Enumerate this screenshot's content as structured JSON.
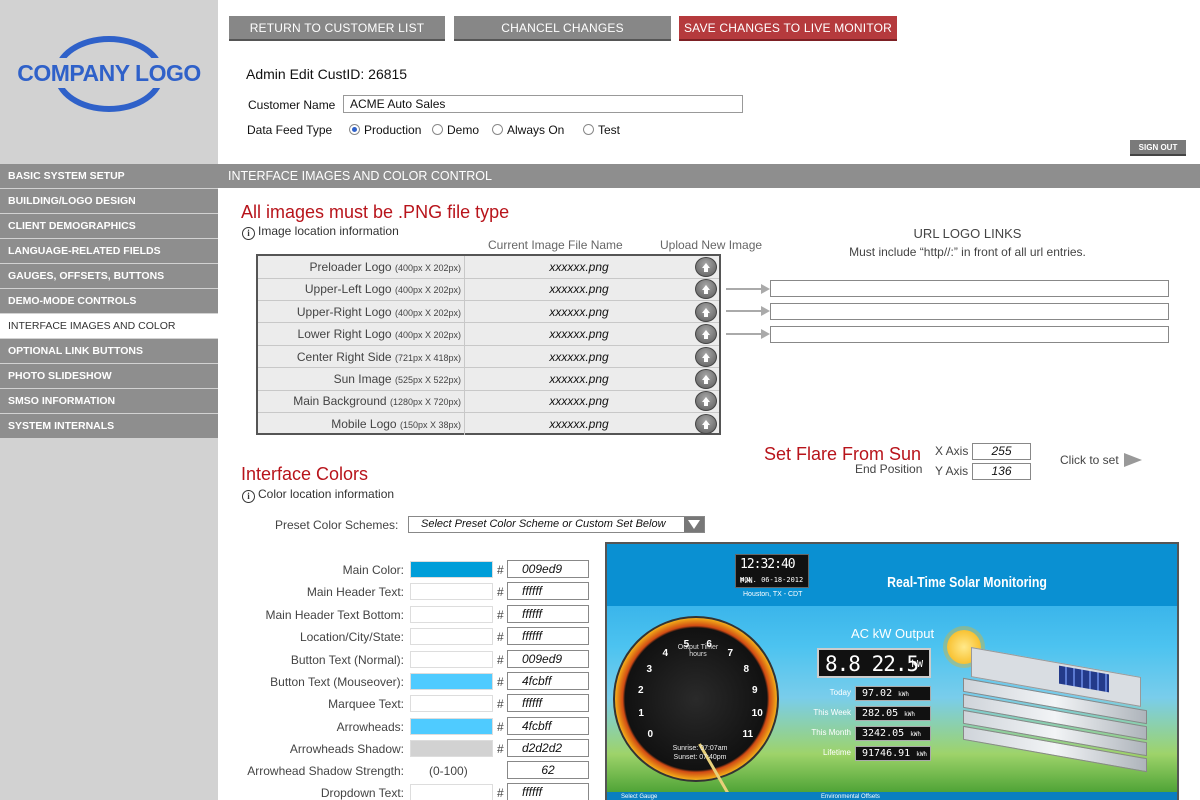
{
  "colors": {
    "brand_blue": "#2f61c9",
    "sidebar_gray": "#8e8e8e",
    "accent_red": "#b53a3d",
    "title_red": "#b8141b"
  },
  "logo": {
    "text": "COMPANY LOGO"
  },
  "top_buttons": {
    "return_label": "RETURN TO CUSTOMER LIST",
    "cancel_label": "CHANCEL CHANGES",
    "save_label": "SAVE CHANGES TO LIVE MONITOR"
  },
  "admin": {
    "title": "Admin Edit CustID: 26815"
  },
  "customer": {
    "name_label": "Customer Name",
    "name_value": "ACME Auto Sales"
  },
  "feed": {
    "label": "Data Feed Type",
    "options": [
      "Production",
      "Demo",
      "Always On",
      "Test"
    ],
    "selected": "Production"
  },
  "signout_label": "SIGN OUT",
  "nav": {
    "items": [
      "BASIC SYSTEM SETUP",
      "BUILDING/LOGO DESIGN",
      "CLIENT DEMOGRAPHICS",
      "LANGUAGE-RELATED FIELDS",
      "GAUGES, OFFSETS, BUTTONS",
      "DEMO-MODE CONTROLS",
      "INTERFACE IMAGES AND COLOR",
      "OPTIONAL LINK BUTTONS",
      "PHOTO SLIDESHOW",
      "SMSO INFORMATION",
      "SYSTEM INTERNALS"
    ],
    "active_index": 6
  },
  "section_title": "INTERFACE IMAGES AND COLOR CONTROL",
  "images": {
    "title": "All images must be .PNG file type",
    "info": "Image location information",
    "col_current": "Current Image File Name",
    "col_upload": "Upload New Image",
    "rows": [
      {
        "name": "Preloader Logo",
        "size": "(400px X 202px)",
        "file": "xxxxxx.png"
      },
      {
        "name": "Upper-Left Logo",
        "size": "(400px X 202px)",
        "file": "xxxxxx.png"
      },
      {
        "name": "Upper-Right Logo",
        "size": "(400px X 202px)",
        "file": "xxxxxx.png"
      },
      {
        "name": "Lower Right Logo",
        "size": "(400px X 202px)",
        "file": "xxxxxx.png"
      },
      {
        "name": "Center Right Side",
        "size": "(721px X 418px)",
        "file": "xxxxxx.png"
      },
      {
        "name": "Sun Image",
        "size": "(525px X 522px)",
        "file": "xxxxxx.png"
      },
      {
        "name": "Main Background",
        "size": "(1280px X 720px)",
        "file": "xxxxxx.png"
      },
      {
        "name": "Mobile Logo",
        "size": "(150px X 38px)",
        "file": "xxxxxx.png"
      }
    ]
  },
  "url_links": {
    "title": "URL LOGO LINKS",
    "subtitle": "Must include “http//:” in front of all url entries.",
    "values": [
      "",
      "",
      ""
    ]
  },
  "flare": {
    "title": "Set Flare From Sun",
    "subtitle": "End Position",
    "x_label": "X Axis",
    "x_value": "255",
    "y_label": "Y Axis",
    "y_value": "136",
    "click_label": "Click to set"
  },
  "colors_section": {
    "title": "Interface Colors",
    "info": "Color location information",
    "preset_label": "Preset Color Schemes:",
    "preset_value": "Select Preset Color Scheme or Custom Set Below",
    "hash": "#",
    "rows": [
      {
        "label": "Main Color:",
        "hex": "009ed9",
        "swatch": "#009ed9"
      },
      {
        "label": "Main Header Text:",
        "hex": "ffffff",
        "swatch": "#ffffff"
      },
      {
        "label": "Main Header Text Bottom:",
        "hex": "ffffff",
        "swatch": "#ffffff"
      },
      {
        "label": "Location/City/State:",
        "hex": "ffffff",
        "swatch": "#ffffff"
      },
      {
        "label": "Button Text (Normal):",
        "hex": "009ed9",
        "swatch": "#ffffff"
      },
      {
        "label": "Button Text (Mouseover):",
        "hex": "4fcbff",
        "swatch": "#4fcbff"
      },
      {
        "label": "Marquee Text:",
        "hex": "ffffff",
        "swatch": "#ffffff"
      },
      {
        "label": "Arrowheads:",
        "hex": "4fcbff",
        "swatch": "#4fcbff"
      },
      {
        "label": "Arrowheads Shadow:",
        "hex": "d2d2d2",
        "swatch": "#d2d2d2"
      }
    ],
    "strength_label": "Arrowhead Shadow Strength:",
    "strength_range": "(0-100)",
    "strength_value": "62",
    "dropdown_label": "Dropdown Text:",
    "dropdown_hex": "ffffff"
  },
  "preview": {
    "clock_time": "12:32:40",
    "clock_suffix": "P.M.",
    "clock_date": "MON. 06-18-2012",
    "location": "Houston, TX - CDT",
    "title": "Real-Time Solar Monitoring",
    "gauge_title": "Output Timer",
    "gauge_sub": "hours",
    "gauge_labels": [
      "0",
      "1",
      "2",
      "3",
      "4",
      "5",
      "6",
      "7",
      "8",
      "9",
      "10",
      "11"
    ],
    "sunrise": "Sunrise: 07:07am",
    "sunset": "Sunset: 07:40pm",
    "ac_title": "AC kW Output",
    "ac_value": "8.8 22.5",
    "ac_unit": "kW",
    "stats": [
      {
        "label": "Today",
        "value": "97.02",
        "unit": "kWh"
      },
      {
        "label": "This Week",
        "value": "282.05",
        "unit": "kWh"
      },
      {
        "label": "This Month",
        "value": "3242.05",
        "unit": "kWh"
      },
      {
        "label": "Lifetime",
        "value": "91746.91",
        "unit": "kWh"
      }
    ],
    "bottom_left": "Select Gauge",
    "bottom_mid": "Environmental Offsets"
  }
}
